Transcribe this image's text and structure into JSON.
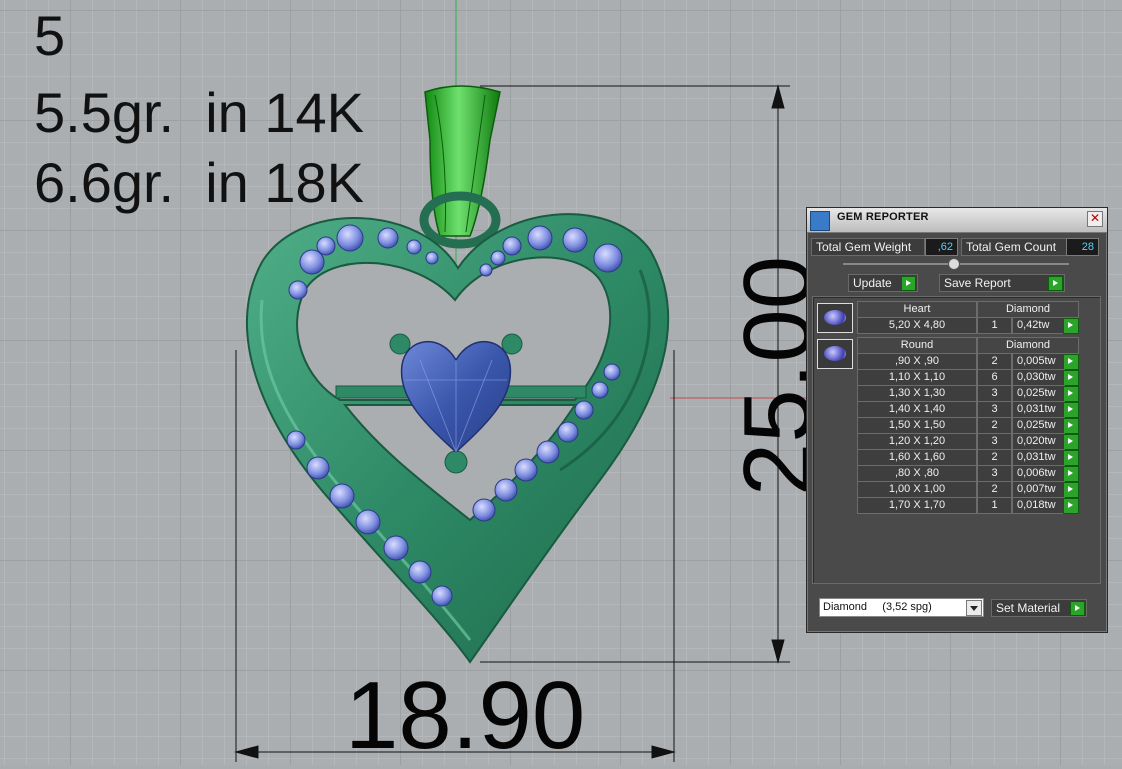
{
  "viewport": {
    "info_lines": [
      "5",
      "5.5gr.  in 14K",
      "6.6gr.  in 18K"
    ],
    "dimension_width": "18.90",
    "dimension_height": "25.00"
  },
  "gem_reporter": {
    "title": "GEM REPORTER",
    "total_weight_label": "Total Gem Weight",
    "total_weight_value": ",62",
    "total_count_label": "Total Gem Count",
    "total_count_value": "28",
    "update_label": "Update",
    "save_report_label": "Save Report",
    "groups": [
      {
        "shape": "Heart",
        "material": "Diamond",
        "rows": [
          {
            "size": "5,20 X 4,80",
            "count": "1",
            "tw": "0,42tw"
          }
        ]
      },
      {
        "shape": "Round",
        "material": "Diamond",
        "rows": [
          {
            "size": ",90 X ,90",
            "count": "2",
            "tw": "0,005tw"
          },
          {
            "size": "1,10 X 1,10",
            "count": "6",
            "tw": "0,030tw"
          },
          {
            "size": "1,30 X 1,30",
            "count": "3",
            "tw": "0,025tw"
          },
          {
            "size": "1,40 X 1,40",
            "count": "3",
            "tw": "0,031tw"
          },
          {
            "size": "1,50 X 1,50",
            "count": "2",
            "tw": "0,025tw"
          },
          {
            "size": "1,20 X 1,20",
            "count": "3",
            "tw": "0,020tw"
          },
          {
            "size": "1,60 X 1,60",
            "count": "2",
            "tw": "0,031tw"
          },
          {
            "size": ",80 X ,80",
            "count": "3",
            "tw": "0,006tw"
          },
          {
            "size": "1,00 X 1,00",
            "count": "2",
            "tw": "0,007tw"
          },
          {
            "size": "1,70 X 1,70",
            "count": "1",
            "tw": "0,018tw"
          }
        ]
      }
    ],
    "material_select_value": "Diamond     (3,52 spg)",
    "set_material_label": "Set Material"
  },
  "colors": {
    "metal_green": "#2e8a66",
    "bail_green": "#22b022",
    "gem_blue": "#3f5fb0",
    "panel_bg": "#4a4a4a",
    "value_cyan": "#58d0ff"
  }
}
